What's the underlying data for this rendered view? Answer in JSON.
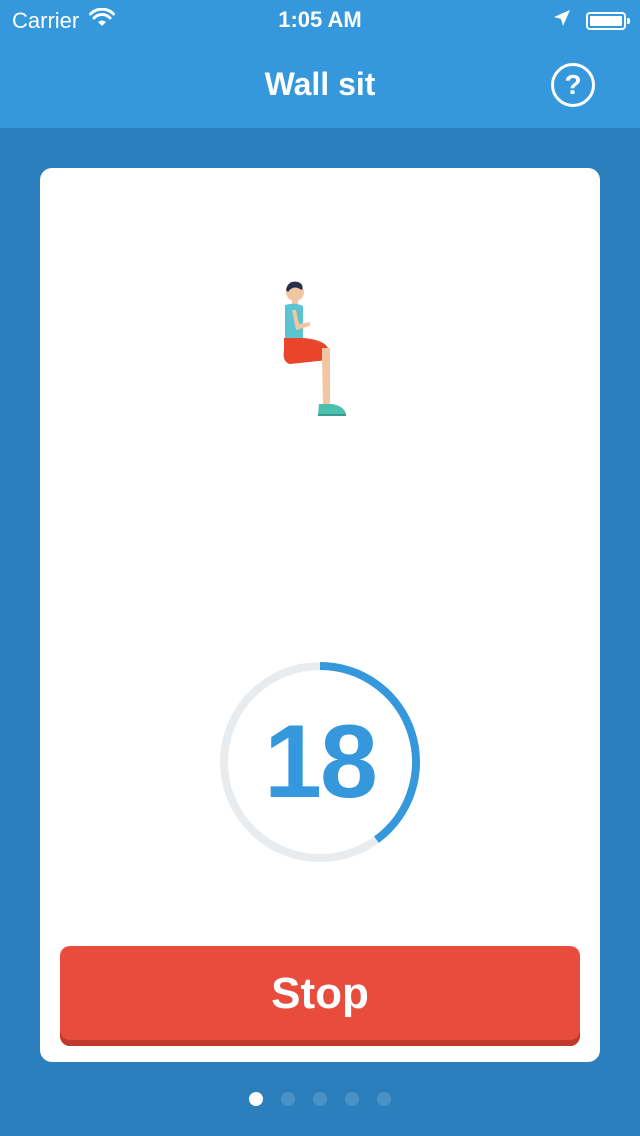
{
  "status_bar": {
    "carrier": "Carrier",
    "time": "1:05 AM"
  },
  "nav": {
    "title": "Wall sit",
    "help_symbol": "?"
  },
  "exercise": {
    "figure_icon": "wall-sit-figure",
    "timer_value": "18",
    "timer_progress": 0.4
  },
  "actions": {
    "stop_label": "Stop"
  },
  "pager": {
    "total": 5,
    "current": 1
  },
  "colors": {
    "nav_blue": "#3597dc",
    "background_blue": "#2a7fbc",
    "timer_blue": "#3597dc",
    "timer_track": "#e9ecee",
    "stop_red": "#e74c3c"
  }
}
